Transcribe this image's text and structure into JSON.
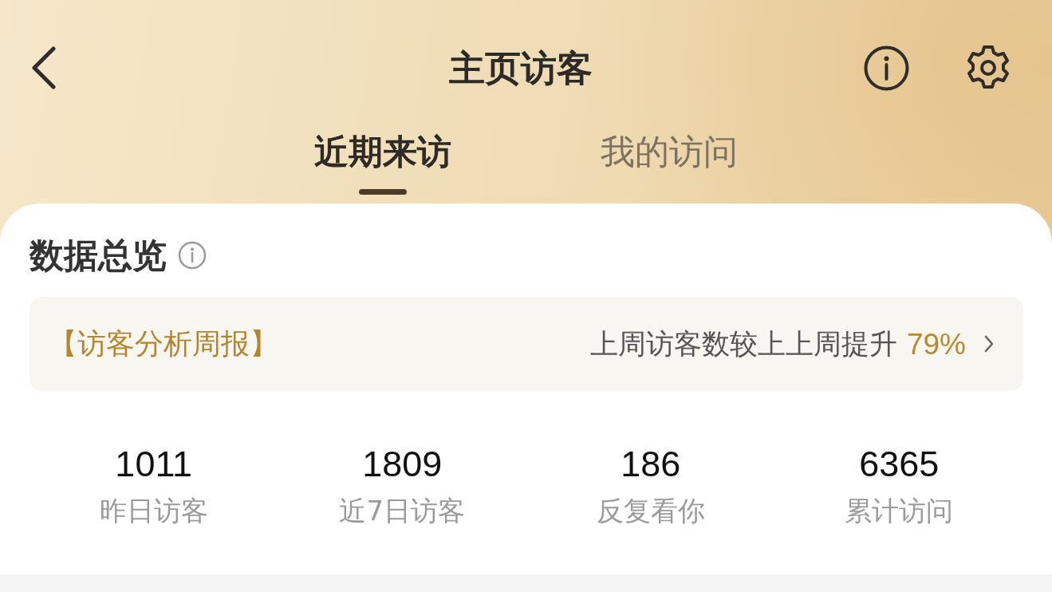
{
  "header": {
    "title": "主页访客"
  },
  "tabs": [
    {
      "label": "近期来访",
      "selected": true
    },
    {
      "label": "我的访问",
      "selected": false
    }
  ],
  "overview": {
    "title": "数据总览",
    "report": {
      "tag": "【访客分析周报】",
      "summary": "上周访客数较上上周提升",
      "change": "79%"
    },
    "stats": [
      {
        "value": "1011",
        "label": "昨日访客"
      },
      {
        "value": "1809",
        "label": "近7日访客"
      },
      {
        "value": "186",
        "label": "反复看你"
      },
      {
        "value": "6365",
        "label": "累计访问"
      }
    ]
  }
}
